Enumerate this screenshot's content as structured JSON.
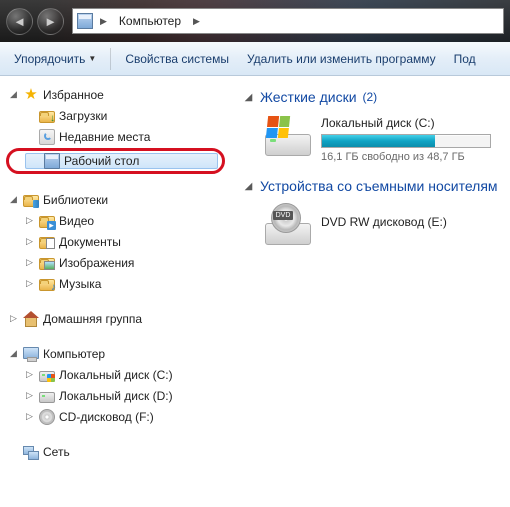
{
  "titlebar": {
    "location_label": "Компьютер"
  },
  "toolbar": {
    "organize": "Упорядочить",
    "system_props": "Свойства системы",
    "uninstall": "Удалить или изменить программу",
    "more": "Под"
  },
  "nav": {
    "favorites": {
      "label": "Избранное",
      "items": [
        "Загрузки",
        "Недавние места",
        "Рабочий стол"
      ]
    },
    "libraries": {
      "label": "Библиотеки",
      "items": [
        "Видео",
        "Документы",
        "Изображения",
        "Музыка"
      ]
    },
    "homegroup": {
      "label": "Домашняя группа"
    },
    "computer": {
      "label": "Компьютер",
      "items": [
        "Локальный диск (C:)",
        "Локальный диск (D:)",
        "CD-дисковод (F:)"
      ]
    },
    "network": {
      "label": "Сеть"
    }
  },
  "content": {
    "hdd_section": {
      "title": "Жесткие диски",
      "count": "(2)",
      "drive_c": {
        "name": "Локальный диск (C:)",
        "free_text": "16,1 ГБ свободно из 48,7 ГБ",
        "used_pct": 67
      }
    },
    "removable_section": {
      "title": "Устройства со съемными носителям",
      "dvd_tag": "DVD",
      "dvd_name": "DVD RW дисковод (E:)"
    }
  }
}
